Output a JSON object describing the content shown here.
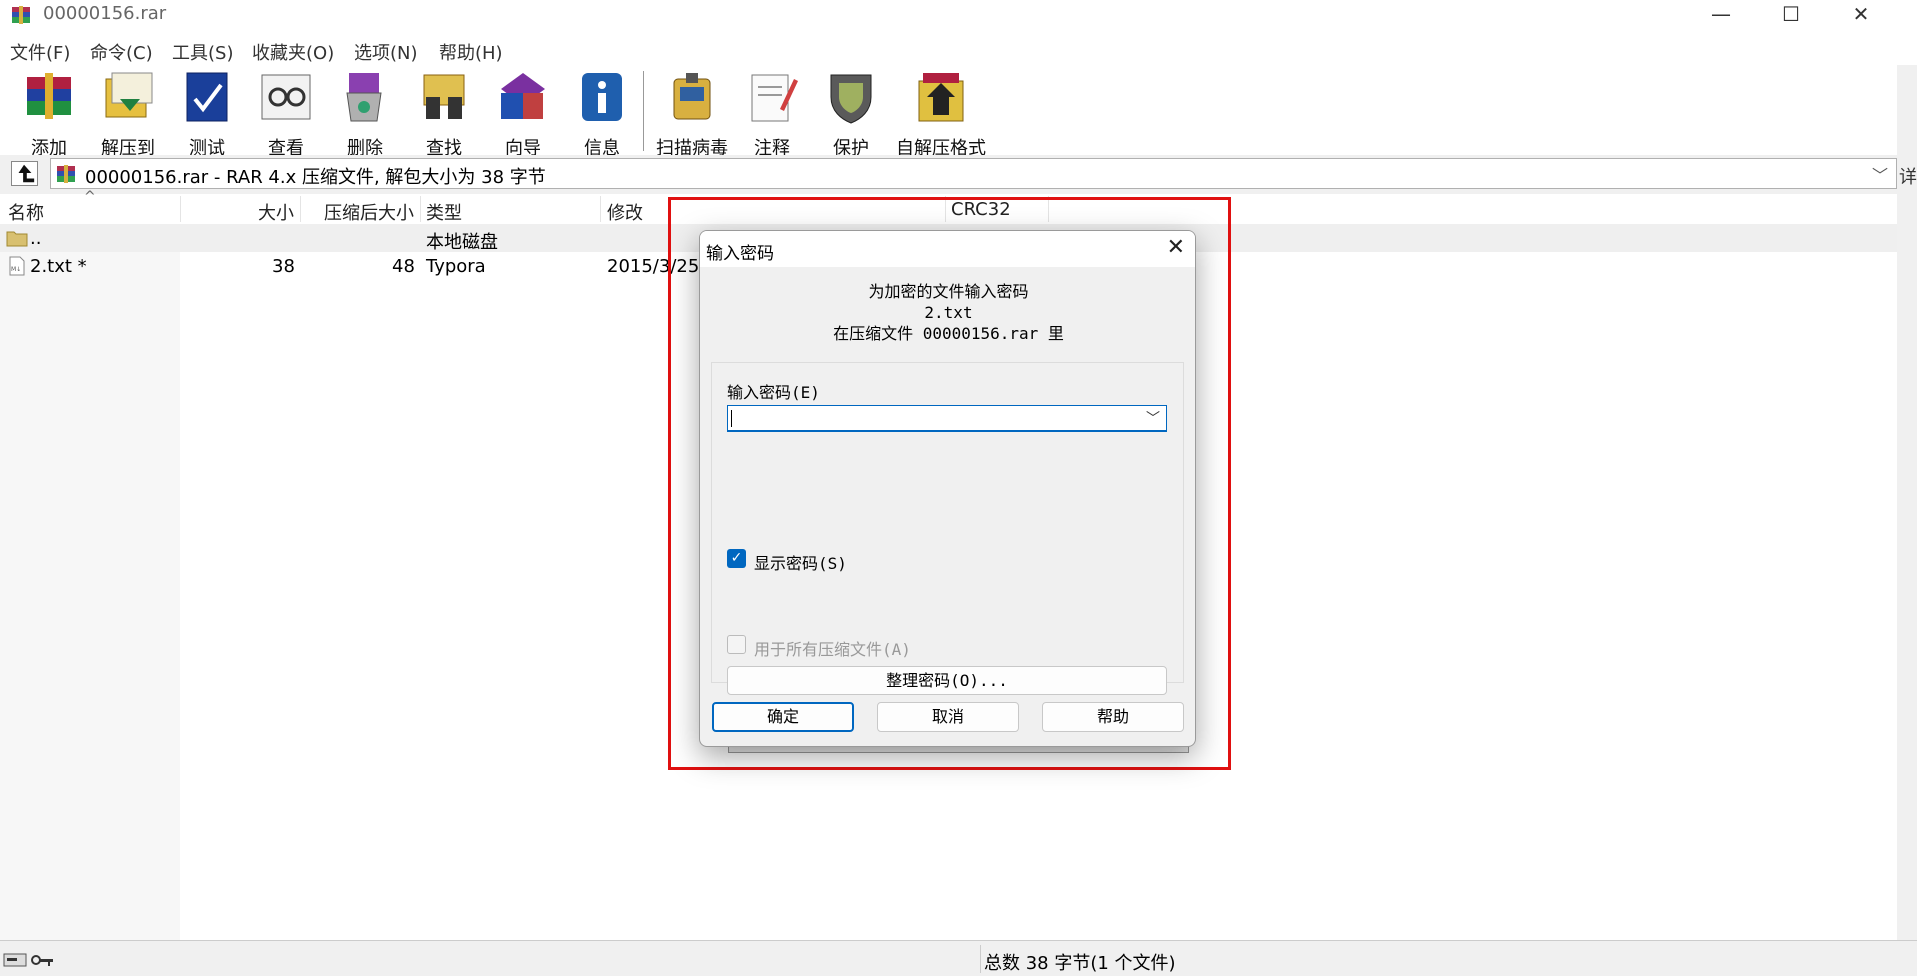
{
  "window": {
    "title": "00000156.rar",
    "controls": {
      "minimize": "—",
      "maximize": "☐",
      "close": "✕"
    }
  },
  "menu": [
    "文件(F)",
    "命令(C)",
    "工具(S)",
    "收藏夹(O)",
    "选项(N)",
    "帮助(H)"
  ],
  "toolbar": [
    {
      "label": "添加",
      "icon": "add-icon",
      "color": "#c03030"
    },
    {
      "label": "解压到",
      "icon": "extract-to-icon",
      "color": "#d8a020"
    },
    {
      "label": "测试",
      "icon": "test-icon",
      "color": "#2050b0"
    },
    {
      "label": "查看",
      "icon": "view-icon",
      "color": "#555555"
    },
    {
      "label": "删除",
      "icon": "delete-icon",
      "color": "#8040a0"
    },
    {
      "label": "查找",
      "icon": "find-icon",
      "color": "#404040"
    },
    {
      "label": "向导",
      "icon": "wizard-icon",
      "color": "#7030a0"
    },
    {
      "label": "信息",
      "icon": "info-icon",
      "color": "#2060b0"
    },
    {
      "label": "扫描病毒",
      "icon": "scan-virus-icon",
      "color": "#406080"
    },
    {
      "label": "注释",
      "icon": "comment-icon",
      "color": "#808080"
    },
    {
      "label": "保护",
      "icon": "protect-icon",
      "color": "#606060"
    },
    {
      "label": "自解压格式",
      "icon": "sfx-icon",
      "color": "#a06020"
    }
  ],
  "address": {
    "text": "00000156.rar - RAR 4.x 压缩文件, 解包大小为 38 字节",
    "right_clip": "详细"
  },
  "columns": [
    "名称",
    "大小",
    "压缩后大小",
    "类型",
    "修改",
    "CRC32"
  ],
  "rows": [
    {
      "name": "..",
      "size": "",
      "packed": "",
      "type": "本地磁盘",
      "modified": "",
      "icon": "folder-icon"
    },
    {
      "name": "2.txt *",
      "size": "38",
      "packed": "48",
      "type": "Typora",
      "modified": "2015/3/25",
      "icon": "text-file-icon"
    }
  ],
  "status": {
    "text": "总数 38 字节(1 个文件)"
  },
  "dialog": {
    "title": "输入密码",
    "info_line1": "为加密的文件输入密码",
    "info_line2": "2.txt",
    "info_line3": "在压缩文件 00000156.rar 里",
    "password_label": "输入密码(E)",
    "password_value": "",
    "show_password_label": "显示密码(S)",
    "show_password_checked": true,
    "use_all_label": "用于所有压缩文件(A)",
    "use_all_checked": false,
    "organize_button": "整理密码(O)...",
    "ok_button": "确定",
    "cancel_button": "取消",
    "help_button": "帮助"
  },
  "colors": {
    "accent": "#0067c0",
    "highlight_border": "#e01010"
  }
}
